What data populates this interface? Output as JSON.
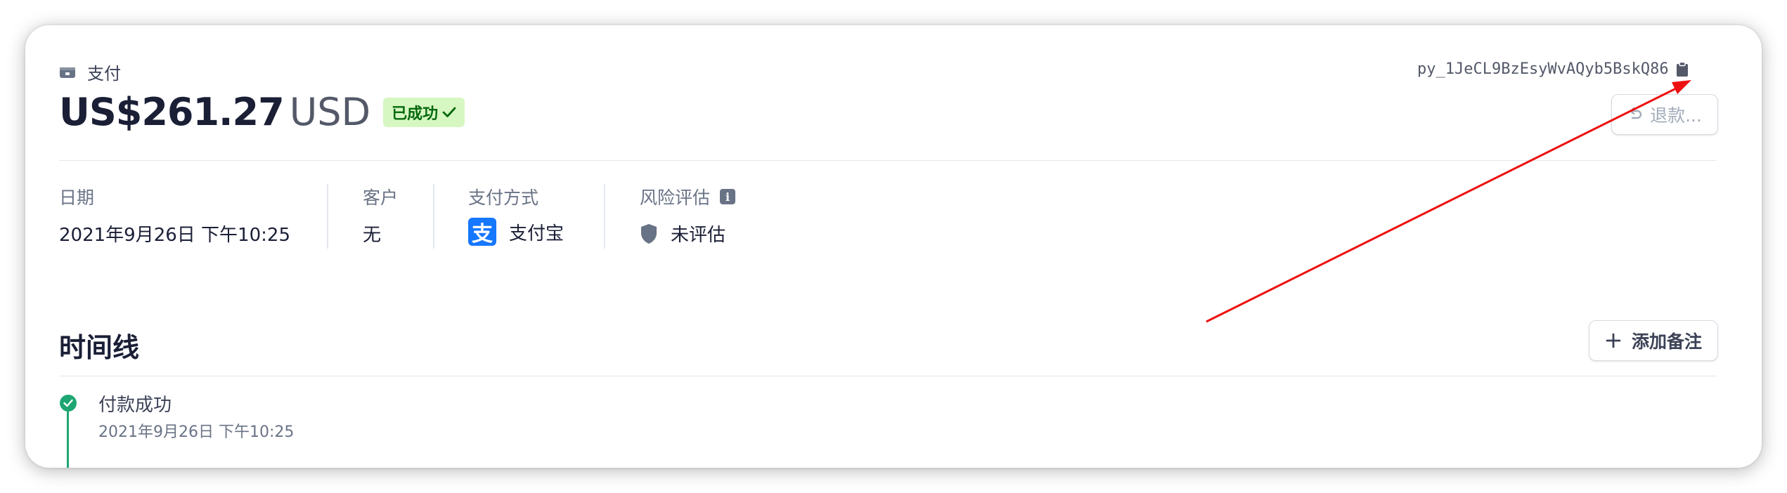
{
  "header": {
    "section_label": "支付",
    "amount": "US$261.27",
    "currency": "USD",
    "status_badge": "已成功",
    "payment_id": "py_1JeCL9BzEsyWvAQyb5BskQ86",
    "refund_button": "退款..."
  },
  "details": {
    "date_label": "日期",
    "date_value": "2021年9月26日 下午10:25",
    "customer_label": "客户",
    "customer_value": "无",
    "payment_method_label": "支付方式",
    "payment_method_value": "支付宝",
    "payment_method_icon": "支",
    "risk_label": "风险评估",
    "risk_value": "未评估"
  },
  "timeline": {
    "title": "时间线",
    "add_note_button": "添加备注",
    "events": [
      {
        "title": "付款成功",
        "time": "2021年9月26日 下午10:25"
      }
    ]
  },
  "colors": {
    "success_green": "#1ea672",
    "badge_bg": "#d7f7c2",
    "badge_text": "#05690d",
    "alipay_blue": "#1677ff",
    "annotation_red": "#ee1111"
  },
  "icons": [
    "wallet-icon",
    "checkmark-icon",
    "clipboard-icon",
    "undo-icon",
    "info-icon",
    "alipay-icon",
    "shield-icon",
    "plus-icon",
    "check-circle-icon"
  ]
}
